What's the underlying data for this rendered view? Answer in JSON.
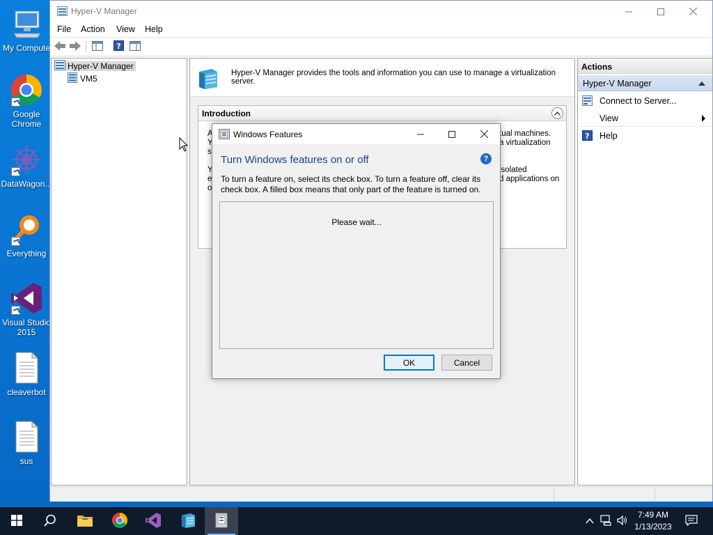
{
  "desktop": {
    "icons": [
      {
        "label": "My Compute"
      },
      {
        "label": "Google Chrome"
      },
      {
        "label": "DataWagon..."
      },
      {
        "label": "Everything"
      },
      {
        "label": "Visual Studio 2015"
      },
      {
        "label": "cleaverbot"
      },
      {
        "label": "sus"
      }
    ]
  },
  "window": {
    "title": "Hyper-V Manager",
    "menu": [
      "File",
      "Action",
      "View",
      "Help"
    ],
    "tree": {
      "root": "Hyper-V Manager",
      "child": "VM5"
    },
    "center": {
      "header_text": "Hyper-V Manager provides the tools and information you can use to manage a virtualization server.",
      "intro_title": "Introduction",
      "intro_fragments": {
        "line1_left": "A",
        "line1_right": "tual machines.",
        "line2_left": "Y",
        "line2_right": "a virtualization",
        "line3_left": "se",
        "line4_left": "Y",
        "line4_right": "isolated",
        "line5_left": "ex",
        "line5_right": "d applications on",
        "line6_left": "o"
      }
    },
    "actions": {
      "title": "Actions",
      "section": "Hyper-V Manager",
      "items": [
        {
          "label": "Connect to Server...",
          "icon": "server-connect-icon"
        },
        {
          "label": "View",
          "icon": "none",
          "has_submenu": true
        },
        {
          "label": "Help",
          "icon": "help-icon"
        }
      ]
    }
  },
  "dialog": {
    "title": "Windows Features",
    "heading": "Turn Windows features on or off",
    "description_line1": "To turn a feature on, select its check box. To turn a feature off, clear its",
    "description_line2": "check box. A filled box means that only part of the feature is turned on.",
    "status": "Please wait...",
    "ok": "OK",
    "cancel": "Cancel"
  },
  "taskbar": {
    "time": "7:49 AM",
    "date": "1/13/2023",
    "accent": "#0078d7"
  }
}
